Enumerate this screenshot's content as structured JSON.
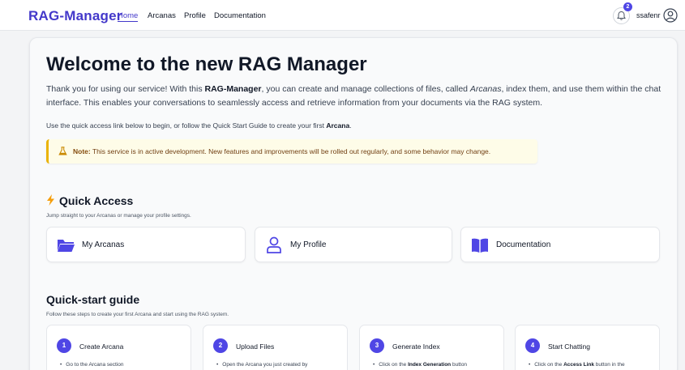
{
  "nav": {
    "brand": "RAG-Manager",
    "links": [
      "Home",
      "Arcanas",
      "Profile",
      "Documentation"
    ],
    "notification_count": "2",
    "username": "ssafenr"
  },
  "hero": {
    "title": "Welcome to the new RAG Manager",
    "intro_1": "Thank you for using our service! With this ",
    "intro_brand": "RAG-Manager",
    "intro_2": ", you can create and manage collections of files, called ",
    "intro_arcanas": "Arcanas",
    "intro_3": ", index them, and use them within the chat interface. This enables your conversations to seamlessly access and retrieve information from your documents via the RAG system.",
    "use_1": "Use the quick access link below to begin, or follow the Quick Start Guide to create your first ",
    "use_arcana": "Arcana",
    "use_2": "."
  },
  "note": {
    "label": "Note:",
    "text": " This service is in active development. New features and improvements will be rolled out regularly, and some behavior may change."
  },
  "quick_access": {
    "title": "Quick Access",
    "subtitle": "Jump straight to your Arcanas or manage your profile settings.",
    "cards": [
      {
        "label": "My Arcanas",
        "icon": "folder-open-icon"
      },
      {
        "label": "My Profile",
        "icon": "user-icon"
      },
      {
        "label": "Documentation",
        "icon": "book-icon"
      }
    ]
  },
  "guide": {
    "title": "Quick-start guide",
    "subtitle": "Follow these steps to create your first Arcana and start using the RAG system.",
    "steps": [
      {
        "num": "1",
        "title": "Create Arcana",
        "desc_1": "Go to the Arcana section",
        "desc_bold": "",
        "desc_2": ""
      },
      {
        "num": "2",
        "title": "Upload Files",
        "desc_1": "Open the Arcana you just created by",
        "desc_bold": "",
        "desc_2": ""
      },
      {
        "num": "3",
        "title": "Generate Index",
        "desc_1": "Click on the ",
        "desc_bold": "Index Generation",
        "desc_2": " button"
      },
      {
        "num": "4",
        "title": "Start Chatting",
        "desc_1": "Click on the ",
        "desc_bold": "Access Link",
        "desc_2": " button in the"
      }
    ]
  },
  "colors": {
    "brand": "#4338ca",
    "accent": "#4f46e5",
    "note_bg": "#fefce8",
    "note_border": "#eab308",
    "bolt": "#f59e0b"
  }
}
